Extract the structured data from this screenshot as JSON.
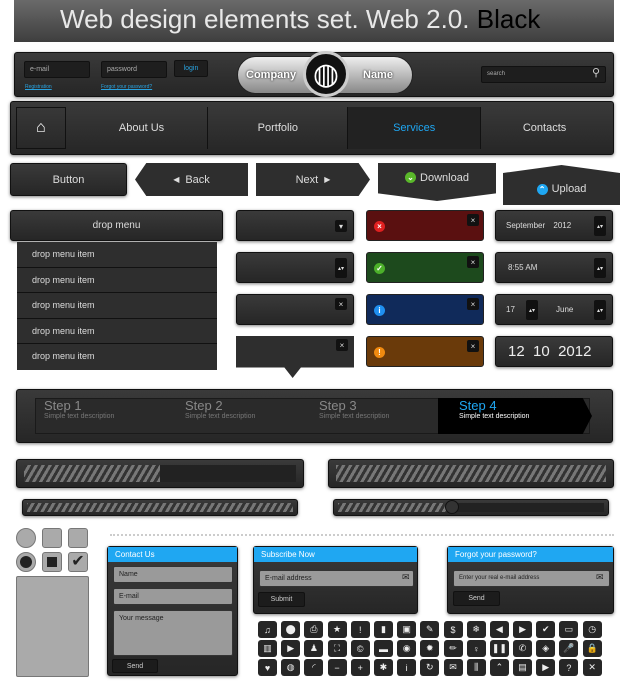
{
  "title": {
    "main": "Web design elements set. Web 2.0.",
    "accent": "Black"
  },
  "header": {
    "email_placeholder": "e-mail",
    "password_placeholder": "password",
    "login": "login",
    "registration": "Registration",
    "forgot": "Forgot your password?",
    "logo_left": "Company",
    "logo_right": "Name",
    "search_placeholder": "search"
  },
  "nav": {
    "items": [
      "About Us",
      "Portfolio",
      "Services",
      "Contacts"
    ],
    "active": "Services"
  },
  "buttons": {
    "button": "Button",
    "back": "Back",
    "next": "Next",
    "download": "Download",
    "upload": "Upload"
  },
  "dropmenu": {
    "title": "drop menu",
    "items": [
      "drop menu item",
      "drop menu item",
      "drop menu item",
      "drop menu item",
      "drop menu item"
    ]
  },
  "date": {
    "month": "September",
    "year": "2012",
    "time": "8:55 AM",
    "day": "17",
    "month2": "June",
    "d": "12",
    "m": "10",
    "y": "2012"
  },
  "steps": [
    {
      "title": "Step 1",
      "desc": "Simple text description"
    },
    {
      "title": "Step 2",
      "desc": "Simple text description"
    },
    {
      "title": "Step 3",
      "desc": "Simple text description"
    },
    {
      "title": "Step 4",
      "desc": "Simple text description"
    }
  ],
  "active_step": 4,
  "progress": {
    "bar1": 50,
    "bar2": 100,
    "slider1": 100,
    "slider2": 43
  },
  "contact": {
    "title": "Contact Us",
    "name": "Name",
    "email": "E-mail",
    "message": "Your message",
    "send": "Send"
  },
  "subscribe": {
    "title": "Subscribe Now",
    "email": "E-mail address",
    "submit": "Submit"
  },
  "forgot": {
    "title": "Forgot your password?",
    "email": "Enter your real e-mail address",
    "send": "Send"
  },
  "colors": {
    "accent": "#1fa7f2",
    "panel": "#2e2e2e",
    "error": "#5a1010",
    "success": "#1d4a1d",
    "info": "#102a5a",
    "warning": "#6a3a0a"
  },
  "icons": [
    "♫",
    "⬤",
    "⎙",
    "★",
    "!",
    "▮",
    "▣",
    "✎",
    "$",
    "❄",
    "◀",
    "▶",
    "✔",
    "▭",
    "◷",
    "▥",
    "▶",
    "♟",
    "⛶",
    "©",
    "▬",
    "◉",
    "✹",
    "✏",
    "♀",
    "❚❚",
    "✆",
    "◈",
    "🎤",
    "🔒",
    "♥",
    "◍",
    "◜",
    "−",
    "+",
    "✱",
    "i",
    "↻",
    "✉",
    "⫼",
    "⌃",
    "▤",
    "▶",
    "?",
    "✕"
  ]
}
